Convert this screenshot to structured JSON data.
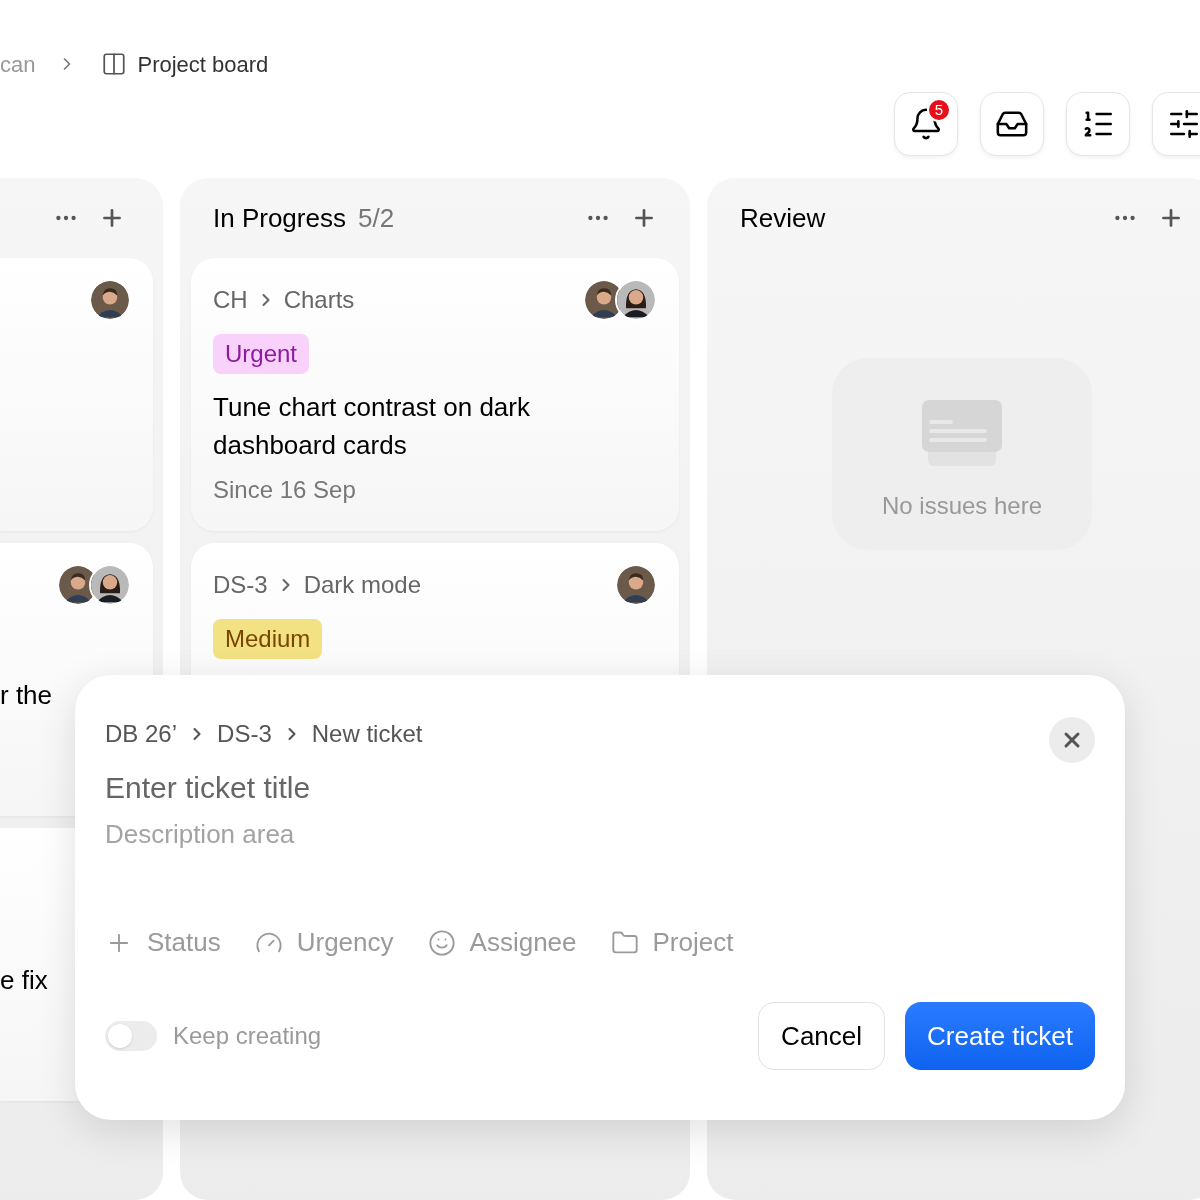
{
  "breadcrumb": [
    "can",
    "Project board"
  ],
  "toolbar": {
    "notification_count": "5"
  },
  "columns": [
    {
      "cards": [
        {
          "assignees": [
            {
              "kind": "man"
            }
          ]
        },
        {
          "assignees": [
            {
              "kind": "man"
            },
            {
              "kind": "woman"
            }
          ],
          "text": "r the"
        },
        {
          "text": "e fix"
        }
      ]
    },
    {
      "title": "In Progress",
      "count": "5/2",
      "cards": [
        {
          "project": "CH",
          "section": "Charts",
          "assignees": [
            {
              "kind": "man"
            },
            {
              "kind": "woman"
            }
          ],
          "tag": {
            "label": "Urgent",
            "kind": "urgent"
          },
          "title": "Tune chart contrast on dark dashboard cards",
          "since": "Since 16 Sep"
        },
        {
          "project": "DS-3",
          "section": "Dark mode",
          "assignees": [
            {
              "kind": "man"
            }
          ],
          "tag": {
            "label": "Medium",
            "kind": "medium"
          }
        }
      ]
    },
    {
      "title": "Review",
      "empty": "No issues here"
    }
  ],
  "modal": {
    "breadcrumb": [
      "DB 26’",
      "DS-3",
      "New ticket"
    ],
    "title_placeholder": "Enter ticket title",
    "description_placeholder": "Description area",
    "properties": [
      {
        "label": "Status",
        "kind": "status"
      },
      {
        "label": "Urgency",
        "kind": "urgency"
      },
      {
        "label": "Assignee",
        "kind": "assignee"
      },
      {
        "label": "Project",
        "kind": "project"
      }
    ],
    "keep_creating": {
      "label": "Keep creating",
      "on": false
    },
    "buttons": [
      {
        "label": "Cancel",
        "kind": "secondary"
      },
      {
        "label": "Create ticket",
        "kind": "primary"
      }
    ]
  }
}
